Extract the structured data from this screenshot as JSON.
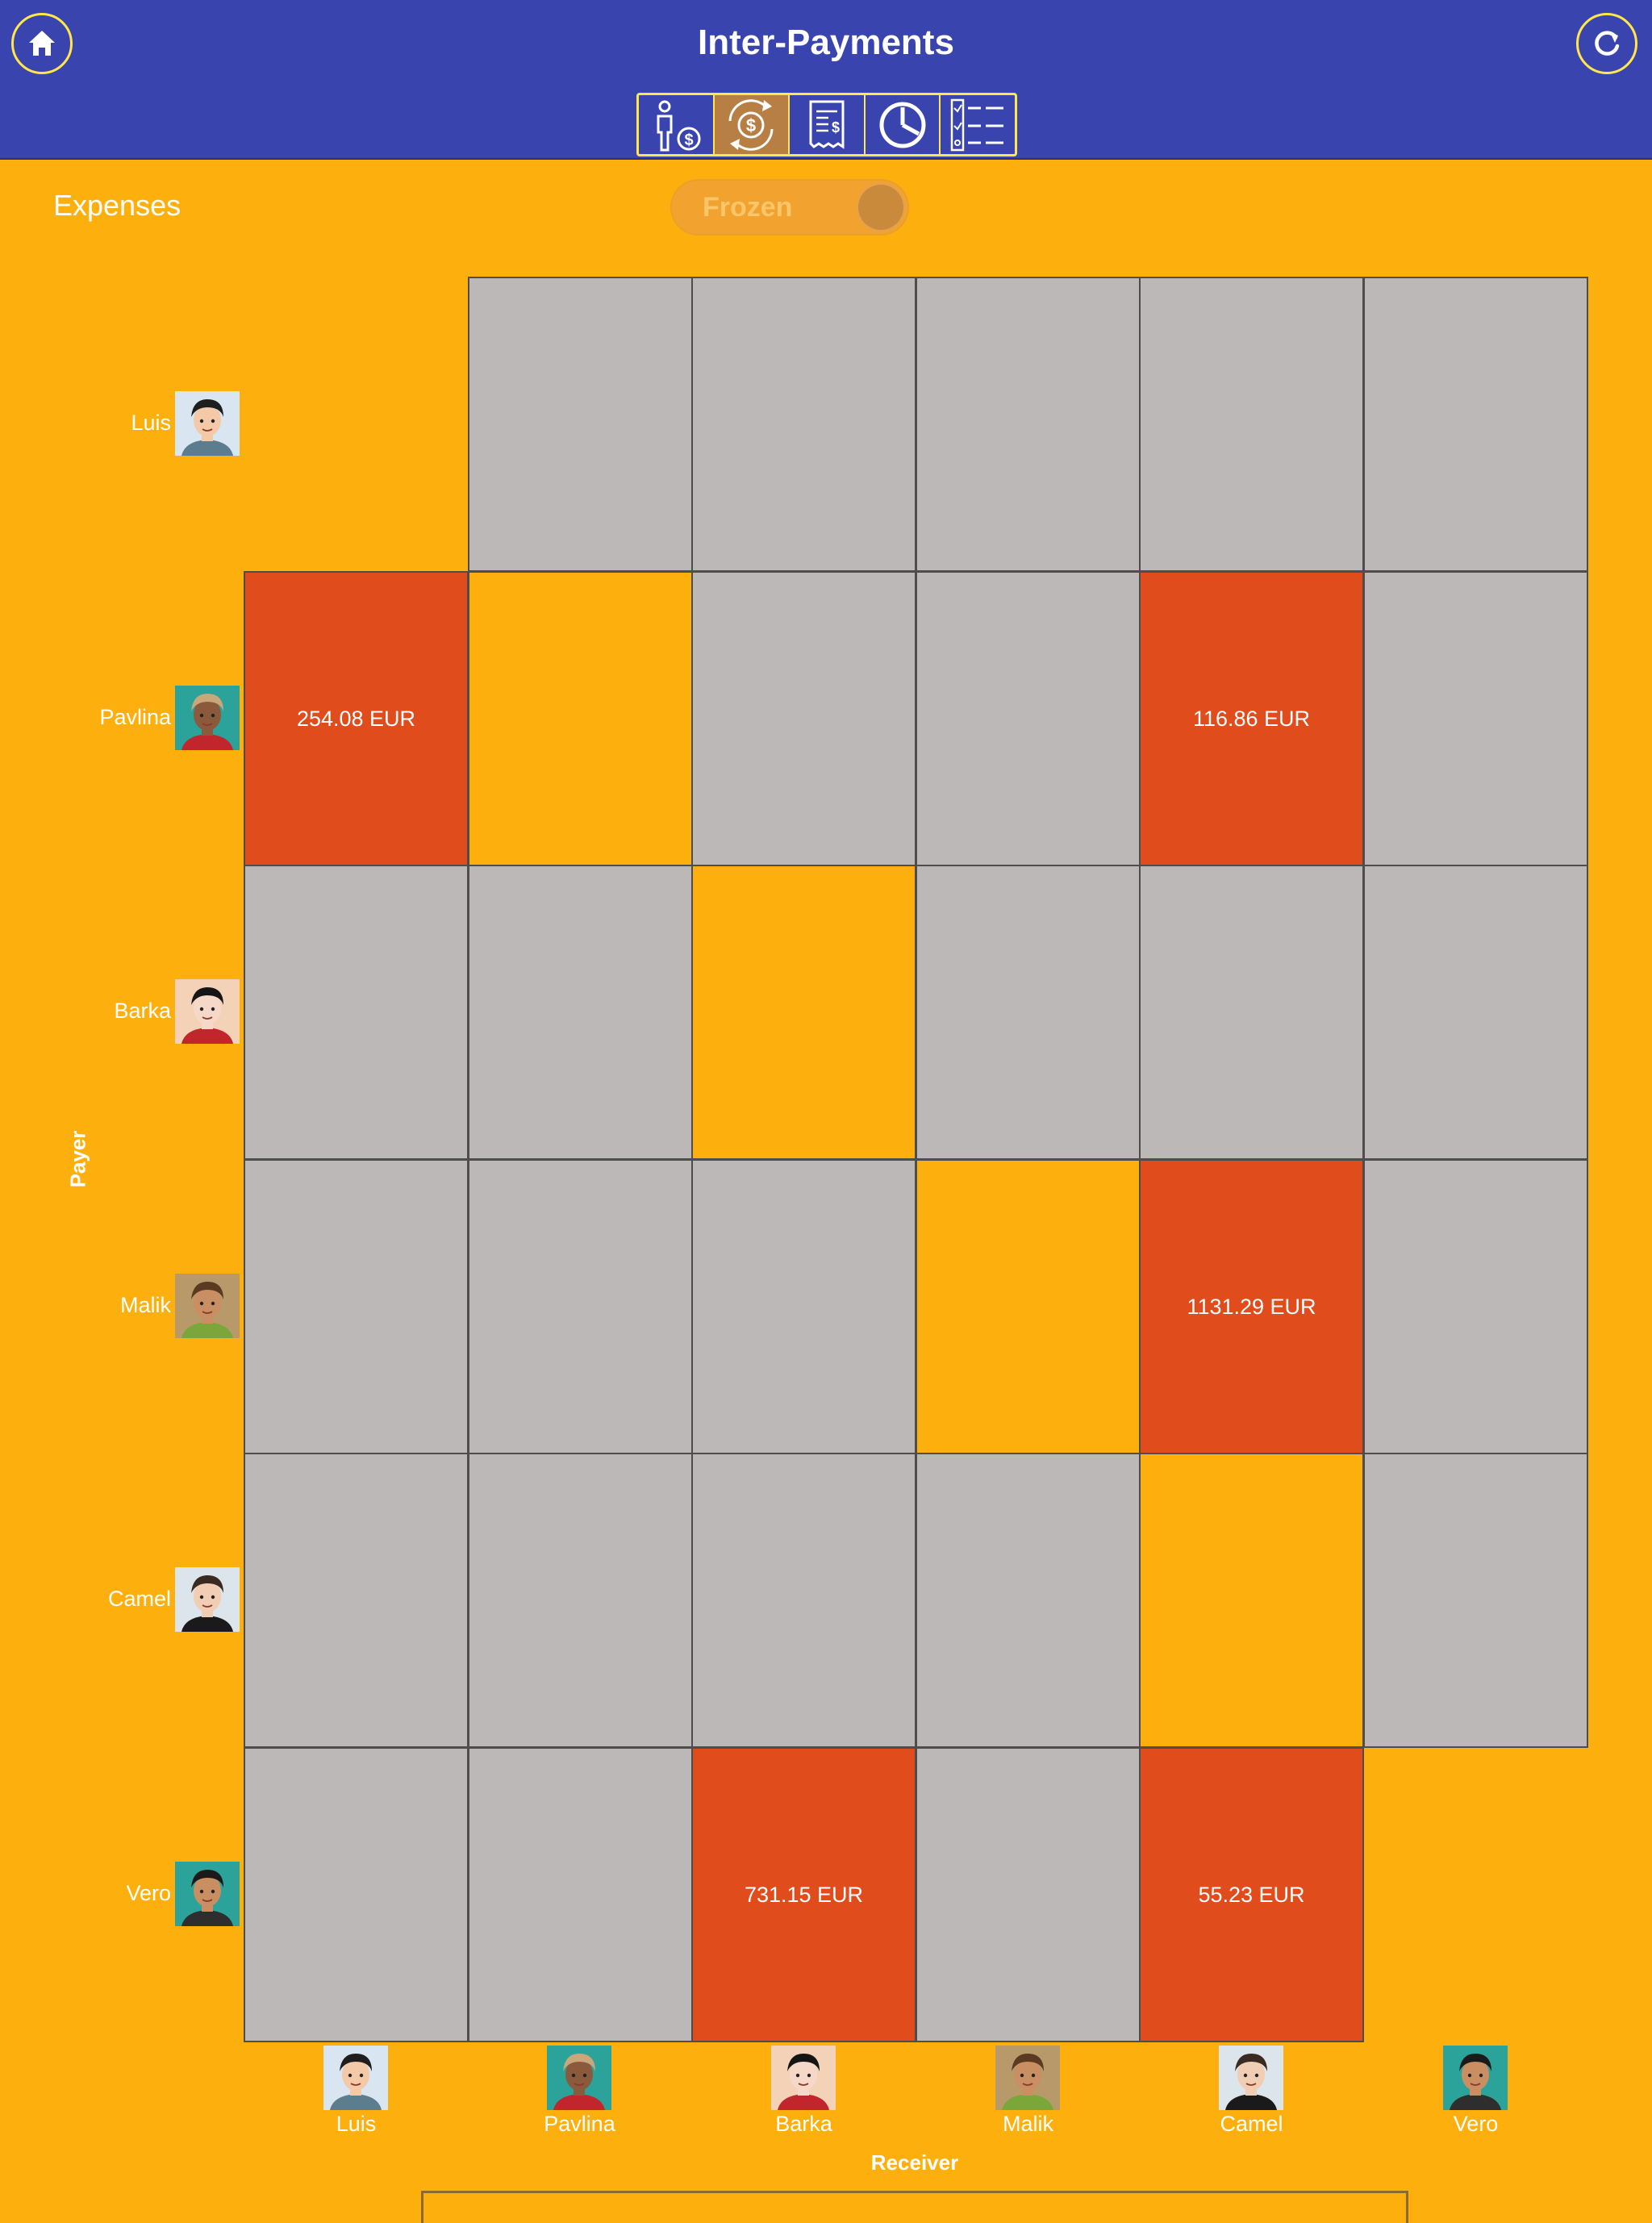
{
  "header": {
    "title": "Inter-Payments",
    "tabs": [
      {
        "name": "members-payments",
        "icon": "person-money-icon",
        "active": false
      },
      {
        "name": "inter-payments",
        "icon": "money-exchange-icon",
        "active": true
      },
      {
        "name": "receipts",
        "icon": "receipt-icon",
        "active": false
      },
      {
        "name": "statistics",
        "icon": "pie-chart-icon",
        "active": false
      },
      {
        "name": "list",
        "icon": "checklist-icon",
        "active": false
      }
    ]
  },
  "toolbar": {
    "section_label": "Expenses",
    "toggle_label": "Frozen",
    "toggle_on": true
  },
  "colors": {
    "background": "#FDB00D",
    "header": "#3A44AE",
    "accent_border": "#FFE64A",
    "cell_empty": "#BCB8B7",
    "cell_amount": "#E04C1C"
  },
  "axes": {
    "payer": "Payer",
    "receiver": "Receiver"
  },
  "members": [
    {
      "name": "Luis",
      "skin": "#F3C9A8",
      "hair": "#1E1E1E",
      "bg": "#D9E6F2",
      "shirt": "#5B7D8E"
    },
    {
      "name": "Pavlina",
      "skin": "#8B5A3C",
      "hair": "#C9A77A",
      "bg": "#2BA39A",
      "shirt": "#C0262B"
    },
    {
      "name": "Barka",
      "skin": "#F6D8C8",
      "hair": "#151515",
      "bg": "#F4D2B8",
      "shirt": "#C0262B"
    },
    {
      "name": "Malik",
      "skin": "#C98E62",
      "hair": "#5A3A22",
      "bg": "#B89A6A",
      "shirt": "#7BA63A"
    },
    {
      "name": "Camel",
      "skin": "#F1CDB3",
      "hair": "#3A2A22",
      "bg": "#DCE5EC",
      "shirt": "#1A1A1A"
    },
    {
      "name": "Vero",
      "skin": "#C98E62",
      "hair": "#1A1A1A",
      "bg": "#2BA39A",
      "shirt": "#2E2E2E"
    }
  ],
  "matrix": [
    [
      null,
      "",
      "",
      "",
      "",
      ""
    ],
    [
      "254.08 EUR",
      "self",
      "",
      "",
      "116.86 EUR",
      ""
    ],
    [
      "",
      "",
      "self",
      "",
      "",
      ""
    ],
    [
      "",
      "",
      "",
      "self",
      "1131.29 EUR",
      ""
    ],
    [
      "",
      "",
      "",
      "",
      "self",
      ""
    ],
    [
      "",
      "",
      "731.15 EUR",
      "",
      "55.23 EUR",
      null
    ]
  ]
}
